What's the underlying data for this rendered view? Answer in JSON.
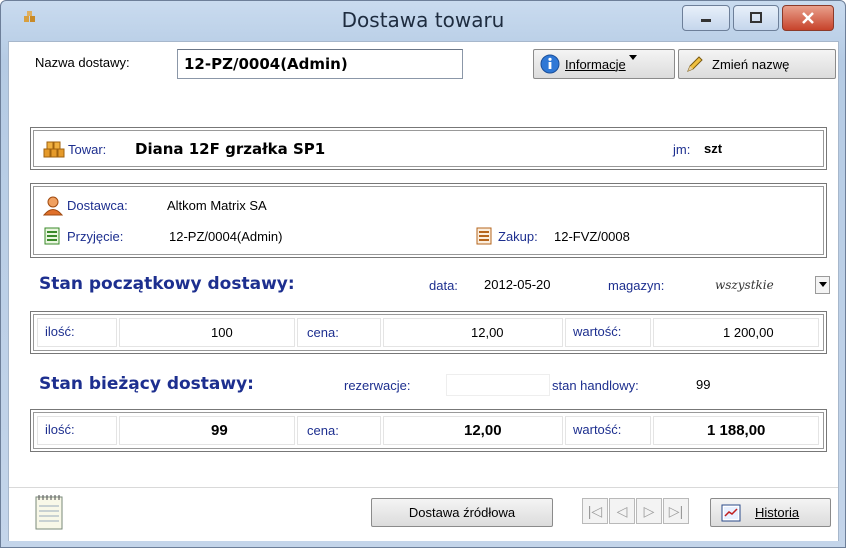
{
  "window": {
    "title": "Dostawa towaru",
    "minimize_icon": "minimize-icon",
    "maximize_icon": "maximize-icon",
    "close_icon": "close-icon"
  },
  "header": {
    "name_label": "Nazwa dostawy:",
    "name_value": "12-PZ/0004(Admin)",
    "info_button": "Informacje",
    "rename_button": "Zmień nazwę"
  },
  "product": {
    "label": "Towar:",
    "value": "Diana 12F grzałka SP1",
    "unit_label": "jm:",
    "unit_value": "szt"
  },
  "supplier": {
    "label": "Dostawca:",
    "value": "Altkom Matrix SA",
    "receipt_label": "Przyjęcie:",
    "receipt_value": "12-PZ/0004(Admin)",
    "purchase_label": "Zakup:",
    "purchase_value": "12-FVZ/0008"
  },
  "initial": {
    "heading": "Stan początkowy dostawy:",
    "date_label": "data:",
    "date_value": "2012-05-20",
    "warehouse_label": "magazyn:",
    "warehouse_value": "wszystkie",
    "qty_label": "ilość:",
    "qty_value": "100",
    "price_label": "cena:",
    "price_value": "12,00",
    "value_label": "wartość:",
    "value_value": "1 200,00"
  },
  "current": {
    "heading": "Stan bieżący dostawy:",
    "reservation_label": "rezerwacje:",
    "reservation_value": "",
    "trade_label": "stan handlowy:",
    "trade_value": "99",
    "qty_label": "ilość:",
    "qty_value": "99",
    "price_label": "cena:",
    "price_value": "12,00",
    "value_label": "wartość:",
    "value_value": "1 188,00"
  },
  "footer": {
    "source_button": "Dostawa źródłowa",
    "history_button": "Historia"
  },
  "colors": {
    "heading_blue": "#1d2f8f",
    "title_bar": "#c9dbef"
  }
}
